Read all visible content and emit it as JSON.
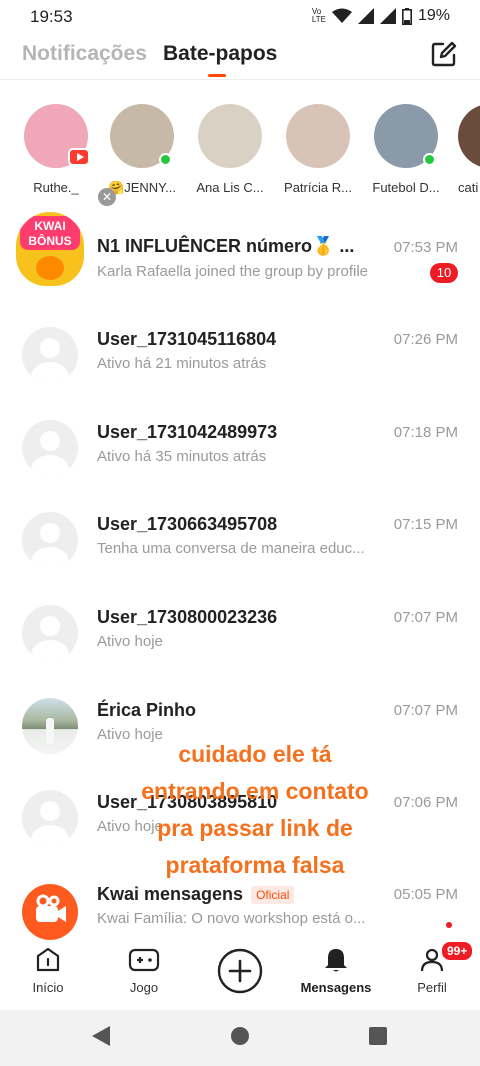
{
  "status": {
    "time": "19:53",
    "battery": "19%",
    "network_top": "Vo",
    "network_bottom": "LTE"
  },
  "header": {
    "tab_notifications": "Notificações",
    "tab_chats": "Bate-papos"
  },
  "stories": [
    {
      "name": "Ruthe._",
      "color": "#f0a8b8",
      "badge": "live"
    },
    {
      "name": "🤗JENNY...",
      "color": "#c7b9a8",
      "badge": "online"
    },
    {
      "name": "Ana Lis C...",
      "color": "#d9d2c4",
      "badge": ""
    },
    {
      "name": "Patrícia R...",
      "color": "#d8c3b7",
      "badge": ""
    },
    {
      "name": "Futebol D...",
      "color": "#8a9aa8",
      "badge": "online"
    },
    {
      "name": "cati",
      "color": "#6b4b3b",
      "badge": ""
    }
  ],
  "chats": [
    {
      "name": "N1 INFLUÊNCER número🥇 ...",
      "message": "Karla Rafaella joined the group by profile",
      "time": "07:53 PM",
      "unread": "10",
      "avatar": "kwai-bonus"
    },
    {
      "name": "User_1731045116804",
      "message": "Ativo há 21 minutos atrás",
      "time": "07:26 PM",
      "unread": "",
      "avatar": "default"
    },
    {
      "name": "User_1731042489973",
      "message": "Ativo há 35 minutos atrás",
      "time": "07:18 PM",
      "unread": "",
      "avatar": "default"
    },
    {
      "name": "User_1730663495708",
      "message": "Tenha uma conversa de maneira educ...",
      "time": "07:15 PM",
      "unread": "",
      "avatar": "default"
    },
    {
      "name": "User_1730800023236",
      "message": "Ativo hoje",
      "time": "07:07 PM",
      "unread": "",
      "avatar": "default"
    },
    {
      "name": "Érica Pinho",
      "message": "Ativo hoje",
      "time": "07:07 PM",
      "unread": "",
      "avatar": "photo"
    },
    {
      "name": "User_1730803895810",
      "message": "Ativo hoje",
      "time": "07:06 PM",
      "unread": "",
      "avatar": "default"
    },
    {
      "name": "Kwai mensagens",
      "official": "Oficial",
      "message": "Kwai Família: O novo workshop está o...",
      "time": "05:05 PM",
      "unread": "dot",
      "avatar": "kwai"
    }
  ],
  "kwai_bonus": {
    "line1": "KWAI",
    "line2": "BÔNUS"
  },
  "overlay": {
    "line1": "cuidado ele tá",
    "line2": "entrando em contato",
    "line3": "pra passar link de",
    "line4": "prataforma falsa"
  },
  "nav": {
    "home": "Início",
    "game": "Jogo",
    "messages": "Mensagens",
    "profile": "Perfil",
    "profile_badge": "99+"
  },
  "colors": {
    "accent": "#ff4906",
    "badge": "#ee1c25",
    "online": "#26c73d",
    "overlay_text": "#f5711d"
  }
}
